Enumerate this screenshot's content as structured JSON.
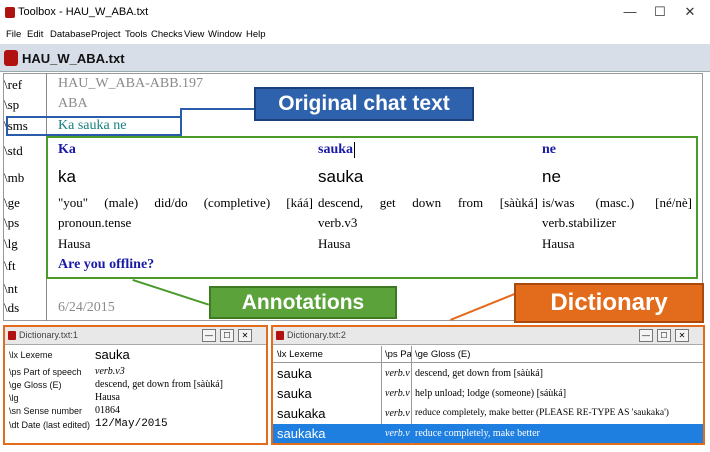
{
  "window": {
    "title": "Toolbox - HAU_W_ABA.txt",
    "minimize": "—",
    "maximize": "☐",
    "close": "✕"
  },
  "menu": [
    "File",
    "Edit",
    "Database",
    "Project",
    "Tools",
    "Checks",
    "View",
    "Window",
    "Help"
  ],
  "document": {
    "title": "HAU_W_ABA.txt"
  },
  "record": {
    "ref": {
      "marker": "\\ref",
      "value": "HAU_W_ABA-ABB.197"
    },
    "sp": {
      "marker": "\\sp",
      "value": "ABA"
    },
    "sms": {
      "marker": "\\sms",
      "value": "Ka sauka ne"
    },
    "std": {
      "marker": "\\std",
      "words": [
        "Ka",
        "sauka",
        "ne"
      ]
    },
    "mb": {
      "marker": "\\mb",
      "words": [
        "ka",
        "sauka",
        "ne"
      ]
    },
    "ge": {
      "marker": "\\ge",
      "words": [
        "\"you\" (male) did/do (completive) [káá]",
        "descend, get down from [sàùká]",
        "is/was (masc.) [né/nè]"
      ]
    },
    "ps": {
      "marker": "\\ps",
      "words": [
        "pronoun.tense",
        "verb.v3",
        "verb.stabilizer"
      ]
    },
    "lg": {
      "marker": "\\lg",
      "words": [
        "Hausa",
        "Hausa",
        "Hausa"
      ]
    },
    "ft": {
      "marker": "\\ft",
      "value": "Are you offline?"
    },
    "nt": {
      "marker": "\\nt",
      "value": ""
    },
    "ds": {
      "marker": "\\ds",
      "value": "6/24/2015"
    }
  },
  "callouts": {
    "original": "Original chat text",
    "annotations": "Annotations",
    "dictionary": "Dictionary"
  },
  "dict1": {
    "title": "Dictionary.txt:1",
    "rows": [
      {
        "marker": "\\lx Lexeme",
        "value": "sauka"
      },
      {
        "marker": "\\ps Part of speech",
        "value": "verb.v3"
      },
      {
        "marker": "\\ge Gloss (E)",
        "value": "descend, get down from [sàùká]"
      },
      {
        "marker": "\\lg",
        "value": "Hausa"
      },
      {
        "marker": "\\sn Sense number",
        "value": "01864"
      },
      {
        "marker": "\\dt Date (last edited)",
        "value": "12/May/2015"
      }
    ]
  },
  "dict2": {
    "title": "Dictionary.txt:2",
    "headers": [
      "\\lx Lexeme",
      "\\ps Pa",
      "\\ge Gloss (E)"
    ],
    "rows": [
      {
        "lx": "sauka",
        "ps": "verb.v",
        "ge": "descend, get down from [sàùká]"
      },
      {
        "lx": "sauka",
        "ps": "verb.v",
        "ge": "help unload; lodge (someone) [sáùká]"
      },
      {
        "lx": "saukaka",
        "ps": "verb.v",
        "ge": "reduce completely, make better (PLEASE RE-TYPE AS 'saukaka')"
      },
      {
        "lx": "saukaka",
        "ps": "verb.v",
        "ge": "reduce completely, make better"
      }
    ]
  },
  "colors": {
    "blue_callout": "#2e62ad",
    "green_callout": "#5ba23a",
    "orange_callout": "#e36c1c",
    "selection": "#1e7fe0"
  }
}
